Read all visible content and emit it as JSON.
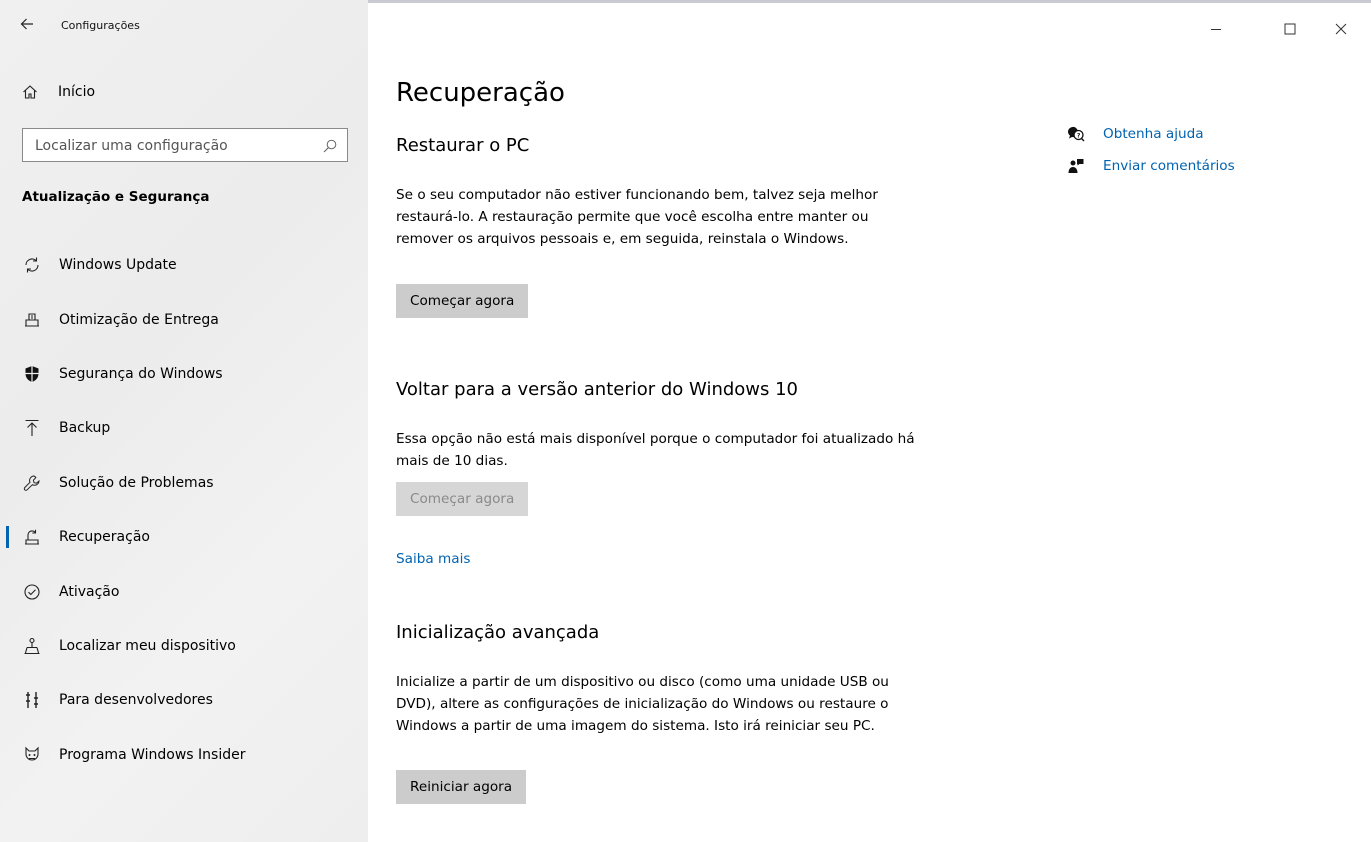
{
  "window": {
    "title": "Configurações",
    "controls": {
      "minimize": "minimize-icon",
      "maximize": "maximize-icon",
      "close": "close-icon"
    }
  },
  "sidebar": {
    "home_label": "Início",
    "search_placeholder": "Localizar uma configuração",
    "section_title": "Atualização e Segurança",
    "items": [
      {
        "label": "Windows Update",
        "icon": "refresh-icon",
        "active": false
      },
      {
        "label": "Otimização de Entrega",
        "icon": "delivery-icon",
        "active": false
      },
      {
        "label": "Segurança do Windows",
        "icon": "shield-icon",
        "active": false
      },
      {
        "label": "Backup",
        "icon": "backup-icon",
        "active": false
      },
      {
        "label": "Solução de Problemas",
        "icon": "wrench-icon",
        "active": false
      },
      {
        "label": "Recuperação",
        "icon": "recovery-icon",
        "active": true
      },
      {
        "label": "Ativação",
        "icon": "check-circle-icon",
        "active": false
      },
      {
        "label": "Localizar meu dispositivo",
        "icon": "find-device-icon",
        "active": false
      },
      {
        "label": "Para desenvolvedores",
        "icon": "developer-icon",
        "active": false
      },
      {
        "label": "Programa Windows Insider",
        "icon": "insider-icon",
        "active": false
      }
    ]
  },
  "main": {
    "title": "Recuperação",
    "sections": [
      {
        "heading": "Restaurar o PC",
        "text": "Se o seu computador não estiver funcionando bem, talvez seja melhor restaurá-lo. A restauração permite que você escolha entre manter ou remover os arquivos pessoais e, em seguida, reinstala o Windows.",
        "button": "Começar agora"
      },
      {
        "heading": "Voltar para a versão anterior do Windows 10",
        "text": "Essa opção não está mais disponível porque o computador foi atualizado há mais de 10 dias.",
        "button": "Começar agora",
        "button_disabled": true,
        "link": "Saiba mais"
      },
      {
        "heading": "Inicialização avançada",
        "text": "Inicialize a partir de um dispositivo ou disco (como uma unidade USB ou DVD), altere as configurações de inicialização do Windows ou restaure o Windows a partir de uma imagem do sistema. Isto irá reiniciar seu PC.",
        "button": "Reiniciar agora"
      }
    ]
  },
  "side_links": [
    {
      "label": "Obtenha ajuda",
      "icon": "help-chat-icon"
    },
    {
      "label": "Enviar comentários",
      "icon": "feedback-icon"
    }
  ],
  "colors": {
    "accent": "#0063b1",
    "button_bg": "#cccccc",
    "sidebar_bg": "#efefef"
  }
}
